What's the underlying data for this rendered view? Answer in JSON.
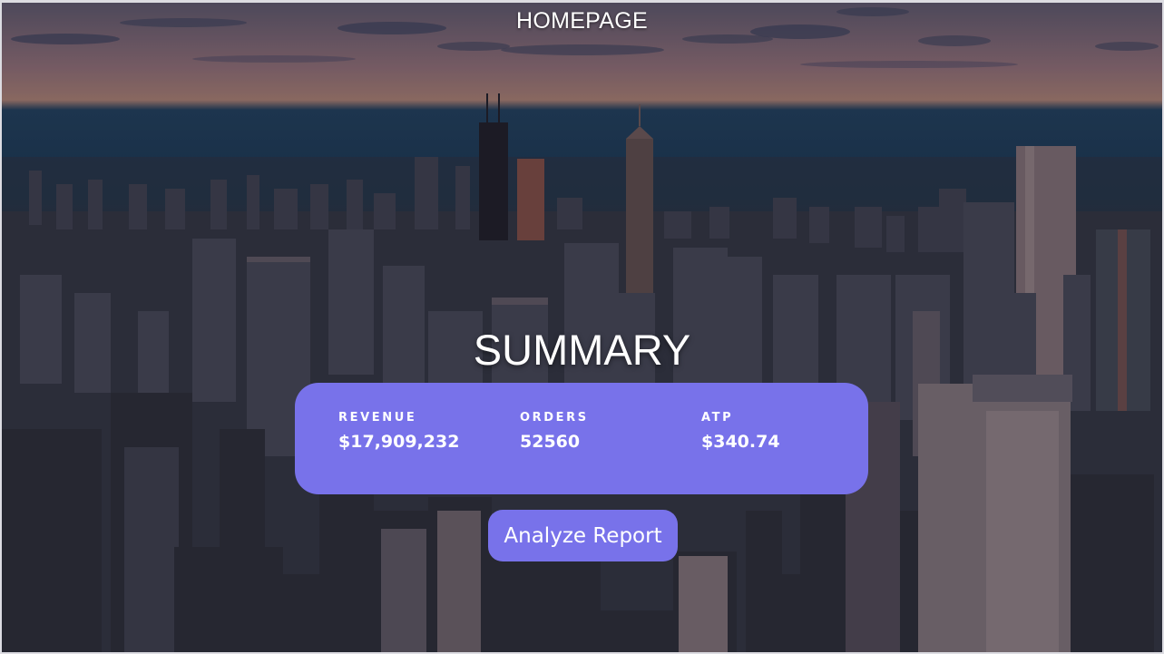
{
  "header": {
    "title": "HOMEPAGE"
  },
  "summary": {
    "title": "SUMMARY",
    "metrics": [
      {
        "label": "REVENUE",
        "value": "$17,909,232"
      },
      {
        "label": "ORDERS",
        "value": "52560"
      },
      {
        "label": "ATP",
        "value": "$340.74"
      }
    ]
  },
  "actions": {
    "analyze_label": "Analyze Report"
  },
  "colors": {
    "accent": "#7872ea",
    "text": "#ffffff"
  }
}
